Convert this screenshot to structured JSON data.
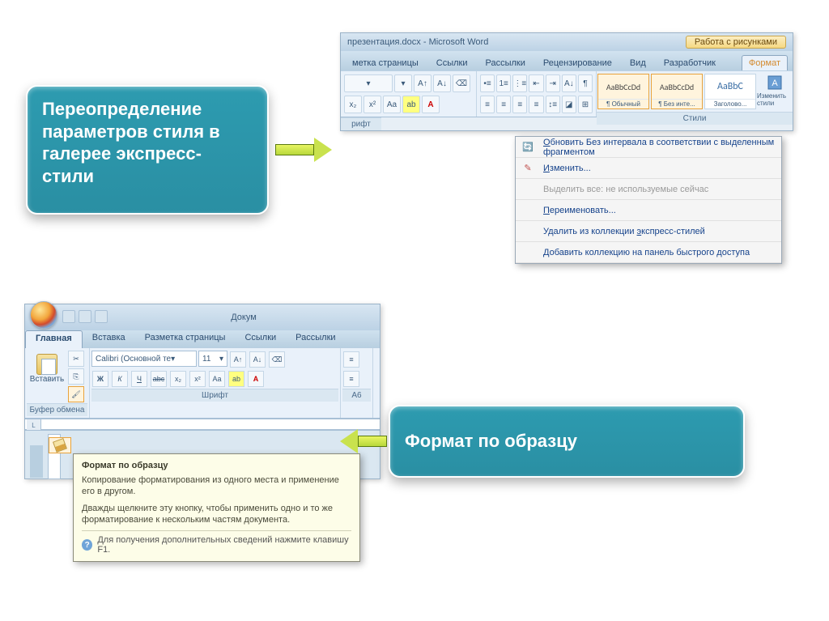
{
  "callout1": "Переопределение параметров стиля в галерее экспресс-стили",
  "callout2": "Формат по образцу",
  "word_top": {
    "title": "презентация.docx - Microsoft Word",
    "title_context": "Работа с рисунками",
    "tabs": [
      "метка страницы",
      "Ссылки",
      "Рассылки",
      "Рецензирование",
      "Вид",
      "Разработчик",
      "Формат"
    ],
    "styles": [
      {
        "preview": "AaBbCcDd",
        "name": "¶ Обычный"
      },
      {
        "preview": "AaBbCcDd",
        "name": "¶ Без инте..."
      },
      {
        "preview": "AaBbC",
        "name": "Заголово..."
      }
    ],
    "change_styles": "Изменить стили",
    "styles_group": "Стили",
    "font_group": "рифт"
  },
  "ctx": [
    {
      "txt": "Обновить Без интервала в соответствии с выделенным фрагментом",
      "u": "О",
      "disabled": false,
      "icon": "update"
    },
    {
      "txt": "Изменить...",
      "u": "И",
      "disabled": false,
      "icon": "edit"
    },
    {
      "txt": "Выделить все: не используемые сейчас",
      "u": "",
      "disabled": true,
      "icon": ""
    },
    {
      "txt": "Переименовать...",
      "u": "П",
      "disabled": false,
      "icon": ""
    },
    {
      "txt": "Удалить из коллекции экспресс-стилей",
      "u": "У",
      "disabled": false,
      "icon": ""
    },
    {
      "txt": "Добавить коллекцию на панель быстрого доступа",
      "u": "Д",
      "disabled": false,
      "icon": ""
    }
  ],
  "word_bot": {
    "doc": "Докум",
    "tabs": [
      "Главная",
      "Вставка",
      "Разметка страницы",
      "Ссылки",
      "Рассылки"
    ],
    "active_tab": "Главная",
    "paste": "Вставить",
    "clipboard_group": "Буфер обмена",
    "font_name": "Calibri (Основной те",
    "font_size": "11",
    "font_group": "Шрифт",
    "para_marker": "А6"
  },
  "tooltip": {
    "title": "Формат по образцу",
    "body1": "Копирование форматирования из одного места и применение его в другом.",
    "body2": "Дважды щелкните эту кнопку, чтобы применить одно и то же форматирование к нескольким частям документа.",
    "help": "Для получения дополнительных сведений нажмите клавишу F1."
  }
}
